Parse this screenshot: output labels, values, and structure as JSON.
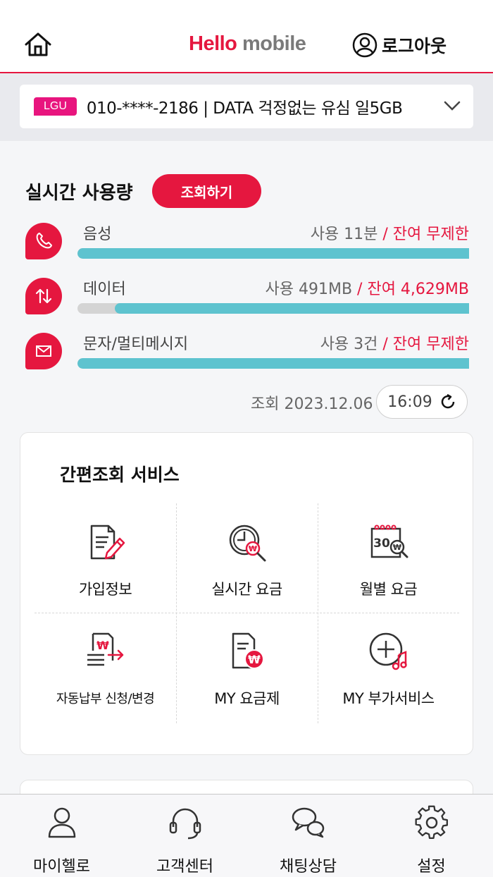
{
  "header": {
    "brand": "Hello",
    "product": "mobile",
    "logout_label": "로그아웃"
  },
  "line": {
    "carrier": "LGU",
    "text": "010-****-2186 | DATA 걱정없는 유심 일5GB"
  },
  "usage": {
    "title": "실시간 사용량",
    "lookup_label": "조회하기",
    "items": [
      {
        "label": "음성",
        "used": "사용 11분",
        "remain": " / 잔여 무제한",
        "remaining_fraction": 1.0,
        "icon": "phone-icon"
      },
      {
        "label": "데이터",
        "used": "사용 491MB",
        "remain": " / 잔여 4,629MB",
        "remaining_fraction": 0.904,
        "icon": "data-transfer-icon"
      },
      {
        "label": "문자/멀티메시지",
        "used": "사용 3건",
        "remain": " / 잔여 무제한",
        "remaining_fraction": 1.0,
        "icon": "mail-icon"
      }
    ],
    "query_label": "조회 2023.12.06",
    "time": "16:09"
  },
  "services": {
    "title": "간편조회 서비스",
    "items": [
      {
        "label": "가입정보",
        "icon": "document-edit-icon"
      },
      {
        "label": "실시간 요금",
        "icon": "clock-won-search-icon"
      },
      {
        "label": "월별 요금",
        "icon": "calendar-won-icon"
      },
      {
        "label": "자동납부 신청/변경",
        "icon": "auto-pay-icon"
      },
      {
        "label": "MY 요금제",
        "icon": "plan-won-icon"
      },
      {
        "label": "MY 부가서비스",
        "icon": "add-music-icon"
      }
    ]
  },
  "nav": [
    {
      "label": "마이헬로",
      "icon": "person-icon"
    },
    {
      "label": "고객센터",
      "icon": "headset-icon"
    },
    {
      "label": "채팅상담",
      "icon": "chat-icon"
    },
    {
      "label": "설정",
      "icon": "gear-icon"
    }
  ],
  "colors": {
    "accent": "#e5173f",
    "badge": "#e8157e",
    "bar": "#5ec3cf",
    "bar_used": "#d4d4d4"
  }
}
